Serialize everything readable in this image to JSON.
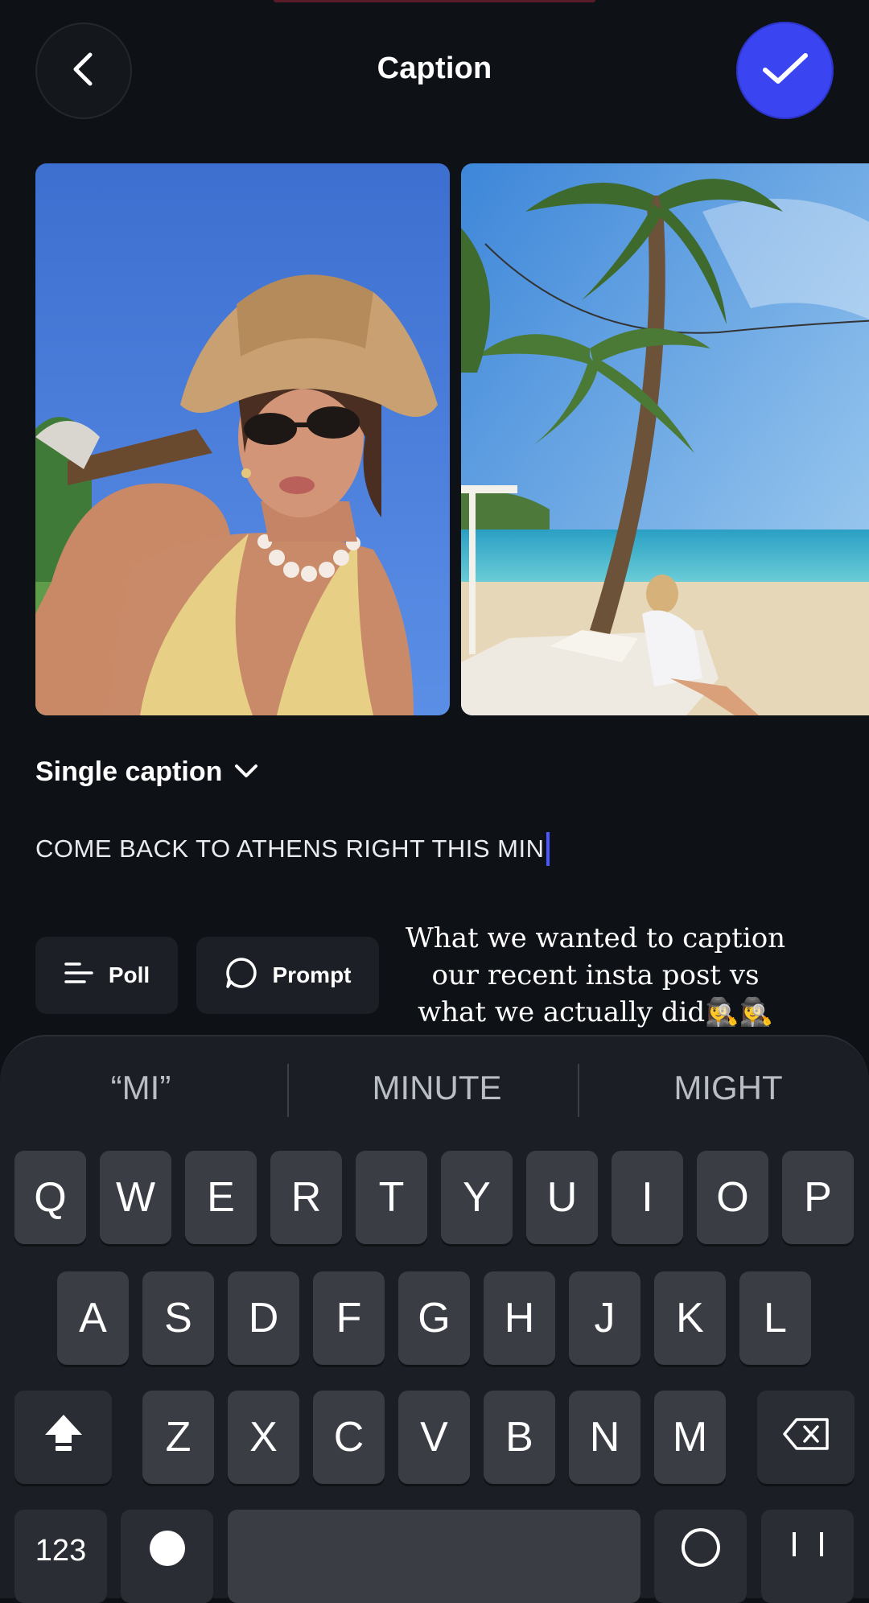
{
  "header": {
    "title": "Caption"
  },
  "photos": [
    {
      "label": "selfie-beach-hat"
    },
    {
      "label": "palm-beach-lounge"
    }
  ],
  "caption": {
    "mode_label": "Single caption",
    "text": "COME BACK TO ATHENS RIGHT THIS MIN"
  },
  "chips": {
    "poll": "Poll",
    "prompt": "Prompt"
  },
  "overlay": {
    "lines": [
      "What we wanted to caption",
      "our recent insta post vs",
      "what we actually did🕵️‍♀️🕵️‍♀️"
    ]
  },
  "keyboard": {
    "suggestions": [
      "“MI”",
      "MINUTE",
      "MIGHT"
    ],
    "row1": [
      "Q",
      "W",
      "E",
      "R",
      "T",
      "Y",
      "U",
      "I",
      "O",
      "P"
    ],
    "row2": [
      "A",
      "S",
      "D",
      "F",
      "G",
      "H",
      "J",
      "K",
      "L"
    ],
    "row3": [
      "Z",
      "X",
      "C",
      "V",
      "B",
      "N",
      "M"
    ],
    "bottom_left": "123"
  },
  "colors": {
    "background": "#0e1116",
    "accent": "#3a44f0",
    "key": "#3a3d43"
  }
}
